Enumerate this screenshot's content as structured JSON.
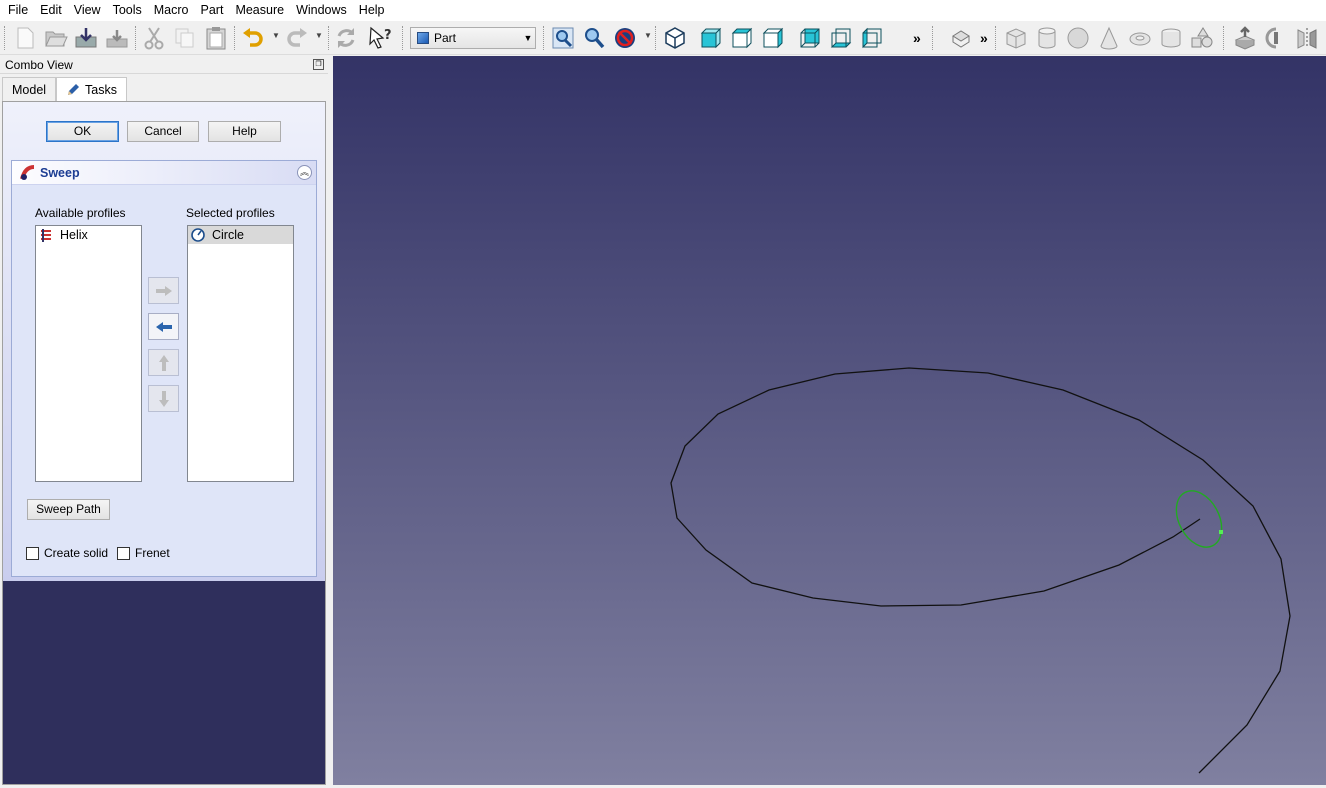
{
  "menu": [
    "File",
    "Edit",
    "View",
    "Tools",
    "Macro",
    "Part",
    "Measure",
    "Windows",
    "Help"
  ],
  "toolbar": {
    "workbench": "Part",
    "icons": [
      "new-document-icon",
      "open-icon",
      "save-icon",
      "save-as-icon",
      "cut-icon",
      "copy-icon",
      "paste-icon",
      "undo-icon",
      "redo-icon",
      "refresh-icon",
      "whats-this-icon",
      "fit-all-icon",
      "fit-selection-icon",
      "draw-style-icon",
      "isometric-view-icon",
      "front-view-icon",
      "top-view-icon",
      "right-view-icon",
      "rear-view-icon",
      "bottom-view-icon",
      "left-view-icon",
      "part-icon",
      "box-icon",
      "cylinder-icon",
      "sphere-icon",
      "cone-icon",
      "torus-icon",
      "tube-icon",
      "primitives-icon",
      "extrude-icon",
      "revolve-icon",
      "mirror-icon"
    ],
    "overflow_label": "»"
  },
  "combo": {
    "title": "Combo View",
    "tabs": [
      "Model",
      "Tasks"
    ]
  },
  "task": {
    "ok": "OK",
    "cancel": "Cancel",
    "help": "Help",
    "panel_title": "Sweep",
    "available_label": "Available profiles",
    "selected_label": "Selected profiles",
    "available_items": [
      "Helix"
    ],
    "selected_items": [
      "Circle"
    ],
    "sweep_path": "Sweep Path",
    "create_solid": "Create solid",
    "frenet": "Frenet",
    "create_solid_checked": false,
    "frenet_checked": false
  },
  "colors": {
    "viewport_top": "#333366",
    "viewport_bottom": "#8080a0",
    "profile_circle": "#22aa22",
    "path_line": "#111111"
  }
}
